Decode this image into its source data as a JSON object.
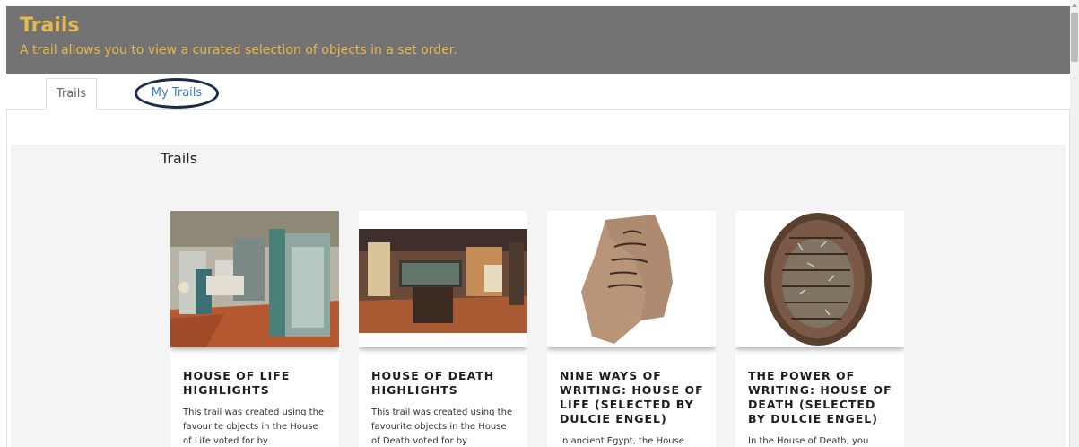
{
  "header": {
    "title": "Trails",
    "subtitle": "A trail allows you to view a curated selection of objects in a set order."
  },
  "tabs": [
    {
      "label": "Trails",
      "active": true
    },
    {
      "label": "My Trails",
      "active": false,
      "highlighted": true
    }
  ],
  "section": {
    "title": "Trails"
  },
  "cards": [
    {
      "title": "HOUSE OF LIFE HIGHLIGHTS",
      "description": "This trail was created using the favourite objects in the House of Life voted for by",
      "image": "gallery-photo"
    },
    {
      "title": "HOUSE OF DEATH HIGHLIGHTS",
      "description": "This trail was created using the favourite objects in the House of Death voted for by",
      "image": "gallery-photo"
    },
    {
      "title": "NINE WAYS OF WRITING: HOUSE OF LIFE (SELECTED BY DULCIE ENGEL)",
      "description": "In ancient Egypt, the House",
      "image": "ostracon-photo"
    },
    {
      "title": "THE POWER OF WRITING: HOUSE OF DEATH (SELECTED BY DULCIE ENGEL)",
      "description": "In the House of Death, you",
      "image": "scarab-photo"
    }
  ],
  "colors": {
    "header_bg": "#737373",
    "header_text": "#e6b84e",
    "link": "#3a7dd1",
    "ring": "#1c2b4a"
  }
}
